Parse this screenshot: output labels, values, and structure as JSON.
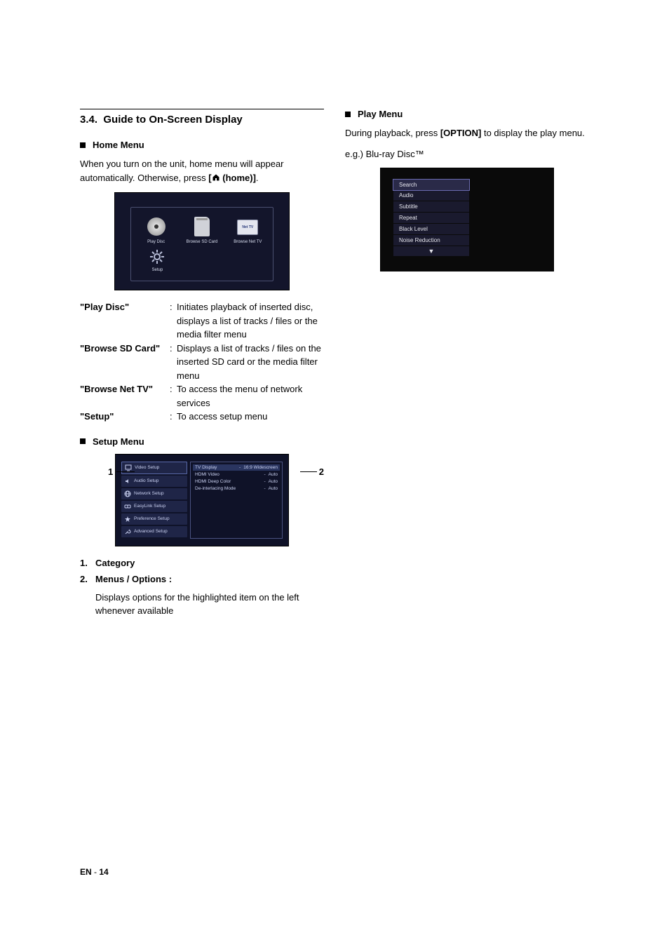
{
  "section_no": "3.4.",
  "section_title": "Guide to On-Screen Display",
  "home_menu": {
    "heading": "Home Menu",
    "intro_a": "When you turn on the unit, home menu will appear automatically. Otherwise, press ",
    "intro_b": "[",
    "intro_c": " (home)]",
    "intro_d": ".",
    "tiles": {
      "play_disc": "Play Disc",
      "browse_sd": "Browse SD Card",
      "browse_net": "Browse Net TV",
      "net_badge": "Net TV",
      "setup": "Setup"
    },
    "defs": [
      {
        "key": "\"Play Disc\"",
        "val": "Initiates playback of inserted disc, displays a list of tracks / files or the media filter menu"
      },
      {
        "key": "\"Browse SD Card\"",
        "val": "Displays a list of tracks / files on the inserted SD card or the media filter menu"
      },
      {
        "key": "\"Browse Net TV\"",
        "val": "To access the menu of network services"
      },
      {
        "key": "\"Setup\"",
        "val": "To access setup menu"
      }
    ]
  },
  "setup_menu": {
    "heading": "Setup Menu",
    "callout_left": "1",
    "callout_right": "2",
    "left_items": [
      "Video Setup",
      "Audio Setup",
      "Network Setup",
      "EasyLink Setup",
      "Preference Setup",
      "Advanced Setup"
    ],
    "right_rows": [
      {
        "label": "TV Display",
        "val": "16:9 Widescreen",
        "sel": true
      },
      {
        "label": "HDMI Video",
        "val": "Auto"
      },
      {
        "label": "HDMI Deep Color",
        "val": "Auto"
      },
      {
        "label": "De-interlacing Mode",
        "val": "Auto"
      }
    ],
    "list": [
      {
        "n": "1.",
        "head": "Category",
        "body": ""
      },
      {
        "n": "2.",
        "head": "Menus / Options :",
        "body": "Displays options for the highlighted item on the left whenever available"
      }
    ]
  },
  "play_menu": {
    "heading": "Play Menu",
    "intro_a": "During playback, press ",
    "intro_b": "[OPTION]",
    "intro_c": " to display the play menu.",
    "eg": "e.g.) Blu-ray Disc™",
    "items": [
      "Search",
      "Audio",
      "Subtitle",
      "Repeat",
      "Black Level",
      "Noise Reduction"
    ],
    "arrow": "▼"
  },
  "footer": {
    "lang": "EN",
    "dash": " - ",
    "page": "14"
  }
}
